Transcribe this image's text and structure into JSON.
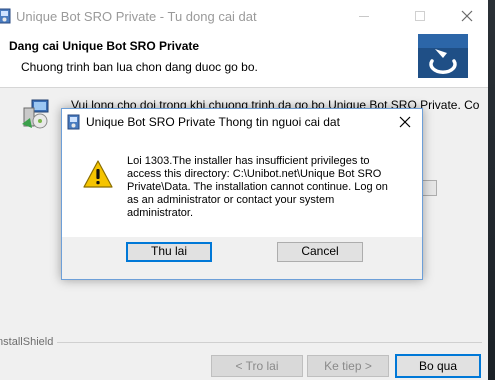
{
  "main_window": {
    "title": "Unique Bot SRO Private - Tu dong cai dat",
    "banner_title": "Dang cai Unique Bot SRO Private",
    "banner_subtitle": "Chuong trinh ban lua chon dang duoc go bo.",
    "body_text": "Vui long cho doi trong khi chuong trinh da go bo Unique Bot SRO Private. Co",
    "brand": "InstallShield",
    "buttons": {
      "back": "< Tro lai",
      "next": "Ke tiep >",
      "cancel": "Bo qua"
    }
  },
  "dialog": {
    "title": "Unique Bot SRO Private Thong tin nguoi cai dat",
    "message_lines": [
      "Loi 1303.The installer has insufficient privileges to",
      "access this directory: C:\\Unibot.net\\Unique Bot SRO",
      "Private\\Data.  The installation cannot continue.  Log on",
      "as an administrator or contact your system",
      "administrator."
    ],
    "buttons": {
      "retry": "Thu lai",
      "cancel": "Cancel"
    }
  },
  "icons": {
    "app": "installer-icon",
    "dialog": "installer-icon",
    "warning": "warning-icon",
    "setup": "setup-computer-icon",
    "logo": "installshield-logo"
  },
  "colors": {
    "accent": "#0078d7",
    "logo_bg": "#1f4f86",
    "warning_fill": "#f5c400"
  }
}
